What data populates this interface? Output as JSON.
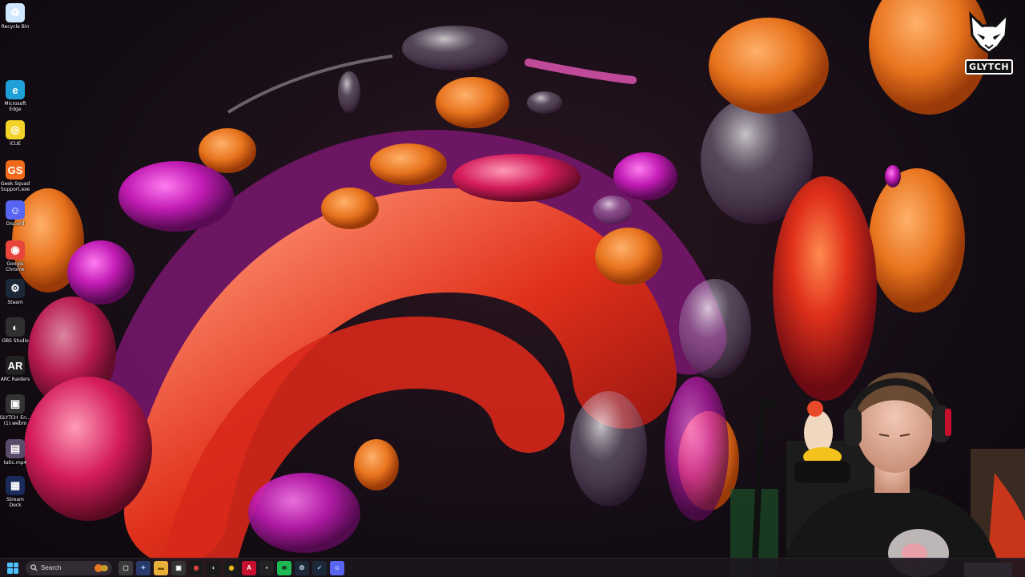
{
  "desktop": {
    "icons": [
      {
        "name": "recycle-bin",
        "label": "Recycle Bin",
        "glyph": "♻",
        "color": "#cfe8ff"
      },
      {
        "name": "microsoft-edge",
        "label": "Microsoft\nEdge",
        "glyph": "e",
        "color": "#1fa0d8"
      },
      {
        "name": "icue",
        "label": "iCUE",
        "glyph": "◎",
        "color": "#f3d22a"
      },
      {
        "name": "geek-squad",
        "label": "Geek Squad\nSupport.exe",
        "glyph": "GS",
        "color": "#f16a1a"
      },
      {
        "name": "discord",
        "label": "Discord",
        "glyph": "☺",
        "color": "#5865f2"
      },
      {
        "name": "google-chrome",
        "label": "Google\nChrome",
        "glyph": "◉",
        "color": "#e8453c"
      },
      {
        "name": "steam",
        "label": "Steam",
        "glyph": "⚙",
        "color": "#1b2838"
      },
      {
        "name": "obs-studio",
        "label": "OBS Studio",
        "glyph": "◐",
        "color": "#302e31"
      },
      {
        "name": "arc-raiders",
        "label": "ARC Raiders",
        "glyph": "AR",
        "color": "#222"
      },
      {
        "name": "glytch-file",
        "label": "GLYTCH_En...\n(1).webm",
        "glyph": "▣",
        "color": "#333"
      },
      {
        "name": "static-video",
        "label": "tatic.mp4",
        "glyph": "▤",
        "color": "#5a4b6a"
      },
      {
        "name": "stream-deck",
        "label": "Stream Deck",
        "glyph": "▦",
        "color": "#1a2a5a"
      }
    ]
  },
  "channel": {
    "name": "GLYTCH"
  },
  "taskbar": {
    "search_placeholder": "Search",
    "apps": [
      {
        "name": "task-view",
        "glyph": "▢",
        "color": "#3a3a3a",
        "fg": "#ddd"
      },
      {
        "name": "copilot",
        "glyph": "✦",
        "color": "#2a3a6a",
        "fg": "#9cf"
      },
      {
        "name": "file-explorer",
        "glyph": "▬",
        "color": "#e8b03a",
        "fg": "#7a4a00"
      },
      {
        "name": "store",
        "glyph": "▣",
        "color": "#333",
        "fg": "#fff"
      },
      {
        "name": "chrome",
        "glyph": "◉",
        "color": "#1a1a1a",
        "fg": "#e8453c"
      },
      {
        "name": "obs",
        "glyph": "◐",
        "color": "#1a1a1a",
        "fg": "#ddd"
      },
      {
        "name": "chrome-2",
        "glyph": "◉",
        "color": "#1a1a1a",
        "fg": "#f2c21a"
      },
      {
        "name": "adobe",
        "glyph": "A",
        "color": "#c8102e",
        "fg": "#fff"
      },
      {
        "name": "camera",
        "glyph": "▪",
        "color": "#222",
        "fg": "#ddd"
      },
      {
        "name": "spotify",
        "glyph": "≋",
        "color": "#1db954",
        "fg": "#111"
      },
      {
        "name": "steam-app",
        "glyph": "⚙",
        "color": "#1b2838",
        "fg": "#cde"
      },
      {
        "name": "app-extra",
        "glyph": "✓",
        "color": "#1b2838",
        "fg": "#9cf"
      },
      {
        "name": "discord-app",
        "glyph": "☺",
        "color": "#5865f2",
        "fg": "#fff"
      }
    ]
  }
}
